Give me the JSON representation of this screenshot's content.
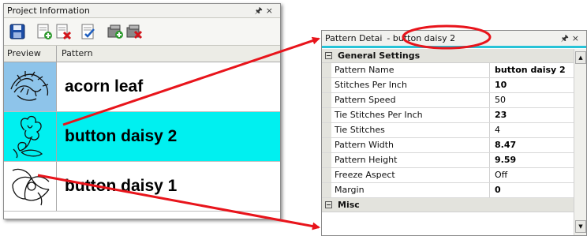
{
  "project_panel": {
    "title": "Project Information",
    "title_icons": [
      "pin-icon",
      "close-icon"
    ],
    "toolbar_icons": [
      "save-icon",
      "add-pattern-icon",
      "remove-pattern-icon",
      "pattern-properties-icon",
      "add-group-icon",
      "remove-group-icon"
    ],
    "columns": [
      "Preview",
      "Pattern"
    ],
    "rows": [
      {
        "name": "acorn leaf",
        "selected": false,
        "preview_icon": "acorn-leaf-pattern-icon"
      },
      {
        "name": "button daisy 2",
        "selected": true,
        "preview_icon": "button-daisy-2-pattern-icon"
      },
      {
        "name": "button daisy 1",
        "selected": false,
        "preview_icon": "button-daisy-1-pattern-icon"
      }
    ]
  },
  "details_panel": {
    "title_prefix": "Pattern Detai",
    "title_highlight": "- button daisy 2",
    "title_icons": [
      "pin-icon",
      "close-icon"
    ],
    "category_general": "General Settings",
    "properties": [
      {
        "label": "Pattern Name",
        "value": "button daisy 2",
        "bold": true
      },
      {
        "label": "Stitches Per Inch",
        "value": "10",
        "bold": true
      },
      {
        "label": "Pattern Speed",
        "value": "50",
        "bold": false
      },
      {
        "label": "Tie Stitches Per Inch",
        "value": "23",
        "bold": true
      },
      {
        "label": "Tie Stitches",
        "value": "4",
        "bold": false
      },
      {
        "label": "Pattern Width",
        "value": "8.47",
        "bold": true
      },
      {
        "label": "Pattern Height",
        "value": "9.59",
        "bold": true
      },
      {
        "label": "Freeze Aspect",
        "value": "Off",
        "bold": false
      },
      {
        "label": "Margin",
        "value": "0",
        "bold": true
      }
    ],
    "category_misc": "Misc"
  },
  "colors": {
    "selection": "#00f0f0",
    "annotation": "#e8141b",
    "panel_accent": "#27c3d7"
  }
}
